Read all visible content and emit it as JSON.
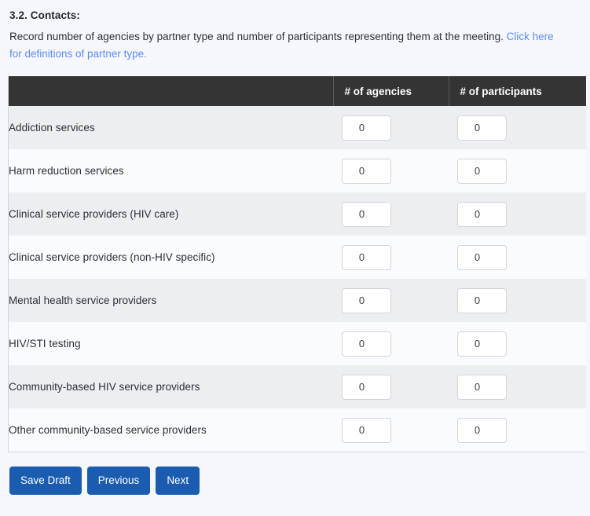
{
  "section": {
    "number_title": "3.2. Contacts:",
    "description_before_link": "Record number of agencies by partner type and number of participants representing them at the meeting. ",
    "link_text": "Click here for definitions of partner type.",
    "link_color": "#5b8def"
  },
  "table": {
    "header_bg": "#343434",
    "columns": [
      {
        "key": "label",
        "label": ""
      },
      {
        "key": "agencies",
        "label": "# of agencies"
      },
      {
        "key": "participants",
        "label": "# of participants"
      }
    ],
    "rows": [
      {
        "label": "Addiction services",
        "agencies": "0",
        "participants": "0"
      },
      {
        "label": "Harm reduction services",
        "agencies": "0",
        "participants": "0"
      },
      {
        "label": "Clinical service providers (HIV care)",
        "agencies": "0",
        "participants": "0"
      },
      {
        "label": "Clinical service providers (non-HIV specific)",
        "agencies": "0",
        "participants": "0"
      },
      {
        "label": "Mental health service providers",
        "agencies": "0",
        "participants": "0"
      },
      {
        "label": "HIV/STI testing",
        "agencies": "0",
        "participants": "0"
      },
      {
        "label": "Community-based HIV service providers",
        "agencies": "0",
        "participants": "0"
      },
      {
        "label": "Other community-based service providers",
        "agencies": "0",
        "participants": "0"
      }
    ]
  },
  "buttons": {
    "accent_color": "#1a5cb0",
    "save_draft": "Save Draft",
    "previous": "Previous",
    "next": "Next"
  }
}
